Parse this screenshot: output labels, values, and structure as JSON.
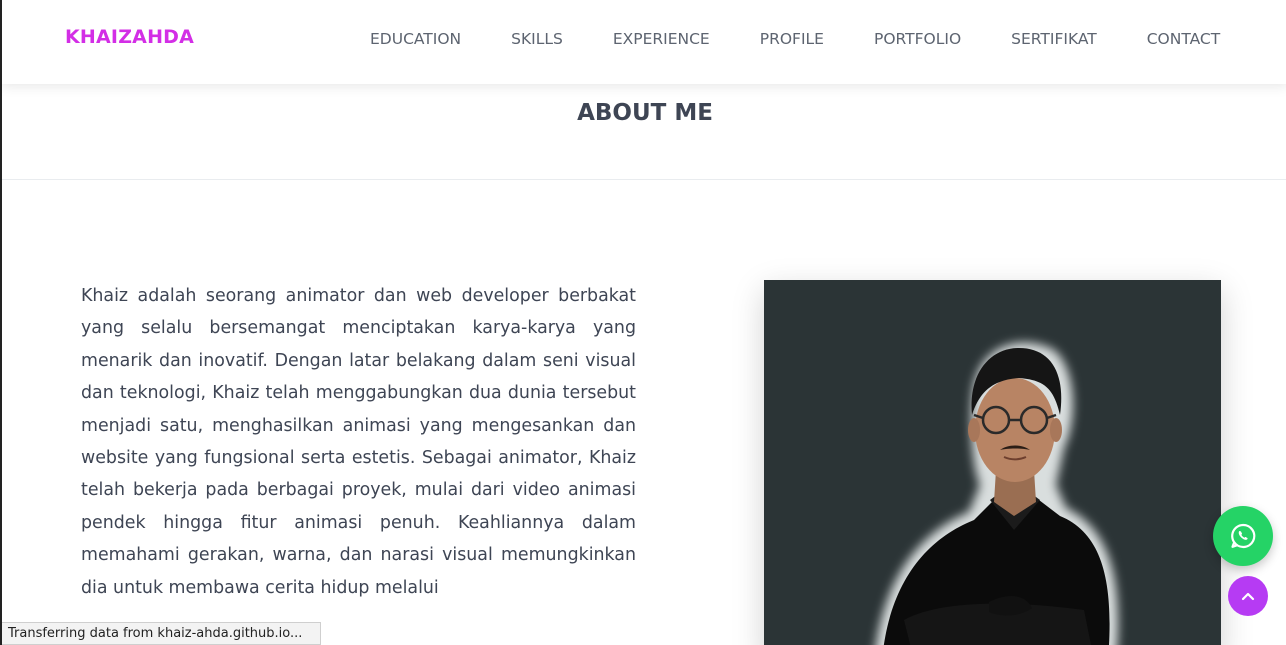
{
  "header": {
    "logo": "KHAIZAHDA",
    "nav": [
      {
        "label": "EDUCATION"
      },
      {
        "label": "SKILLS"
      },
      {
        "label": "EXPERIENCE"
      },
      {
        "label": "PROFILE"
      },
      {
        "label": "PORTFOLIO"
      },
      {
        "label": "SERTIFIKAT"
      },
      {
        "label": "CONTACT"
      }
    ]
  },
  "section": {
    "title": "ABOUT ME"
  },
  "about": {
    "text": "Khaiz adalah seorang animator dan web developer berbakat yang selalu bersemangat menciptakan karya-karya yang menarik dan inovatif. Dengan latar belakang dalam seni visual dan teknologi, Khaiz telah menggabungkan dua dunia tersebut menjadi satu, menghasilkan animasi yang mengesankan dan website yang fungsional serta estetis. Sebagai animator, Khaiz telah bekerja pada berbagai proyek, mulai dari video animasi pendek hingga fitur animasi penuh. Keahliannya dalam memahami gerakan, warna, dan narasi visual memungkinkan dia untuk membawa cerita hidup melalui"
  },
  "floating": {
    "whatsapp_icon": "whatsapp-icon",
    "top_icon": "chevron-up-icon"
  },
  "status_bar": {
    "text": "Transferring data from khaiz-ahda.github.io..."
  },
  "colors": {
    "brand": "#d32ee6",
    "whatsapp": "#25d366",
    "back_to_top": "#b63bf3",
    "photo_bg": "#2b3436",
    "text": "#3e4554"
  }
}
